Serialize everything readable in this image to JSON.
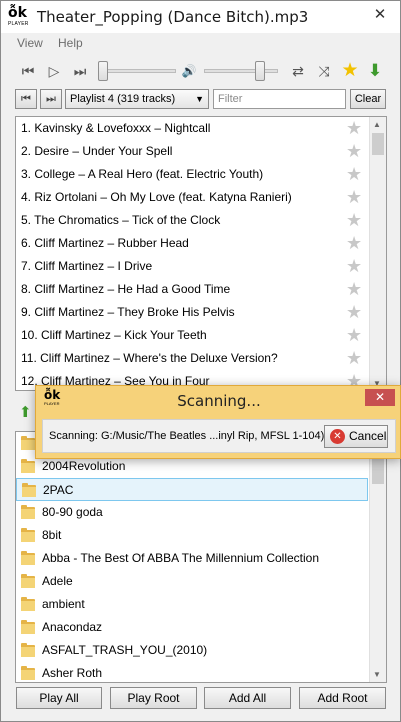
{
  "window": {
    "title": "Theater_Popping (Dance Bitch).mp3",
    "logo_glyph": "ỗk",
    "logo_sub": "PLAYER",
    "close_glyph": "✕"
  },
  "menu": {
    "items": [
      "View",
      "Help"
    ]
  },
  "toolbar": {
    "prev_glyph": "⏮",
    "play_glyph": "▷",
    "next_glyph": "⏭",
    "volume_glyph": "🔊",
    "repeat_glyph": "⇄",
    "shuffle_glyph": "⤨",
    "favorite_glyph": "★",
    "download_glyph": "⬇",
    "seek_position": 0.0,
    "volume_level": 0.8,
    "colors": {
      "favorite": "#f2c200",
      "download": "#3e9a2d"
    }
  },
  "playlist": {
    "selected": "Playlist 4 (319 tracks)",
    "filter_placeholder": "Filter",
    "clear_label": "Clear",
    "btn_a_glyph": "⏮",
    "btn_b_glyph": "⏭"
  },
  "tracks": [
    "1. Kavinsky & Lovefoxxx – Nightcall",
    "2. Desire – Under Your Spell",
    "3. College – A Real Hero (feat. Electric Youth)",
    "4. Riz Ortolani – Oh My Love (feat. Katyna Ranieri)",
    "5. The Chromatics – Tick of the Clock",
    "6. Cliff Martinez – Rubber Head",
    "7. Cliff Martinez – I Drive",
    "8. Cliff Martinez – He Had a Good Time",
    "9. Cliff Martinez – They Broke His Pelvis",
    "10. Cliff Martinez – Kick Your Teeth",
    "11. Cliff Martinez – Where's the Deluxe Version?",
    "12. Cliff Martinez – See You in Four"
  ],
  "folders": [
    "..",
    "2004Revolution",
    "2PAC",
    "80-90 goda",
    "8bit",
    "Abba - The Best Of ABBA The Millennium Collection",
    "Adele",
    "ambient",
    "Anacondaz",
    "ASFALT_TRASH_YOU_(2010)",
    "Asher Roth"
  ],
  "folders_selected_index": 2,
  "bottom_buttons": [
    "Play All",
    "Play Root",
    "Add All",
    "Add Root"
  ],
  "dialog": {
    "title": "Scanning...",
    "message": "Scanning: G:/Music/The Beatles ...inyl Rip, MFSL 1-104)",
    "cancel_label": "Cancel",
    "close_glyph": "✕",
    "cancel_glyph": "✕"
  }
}
